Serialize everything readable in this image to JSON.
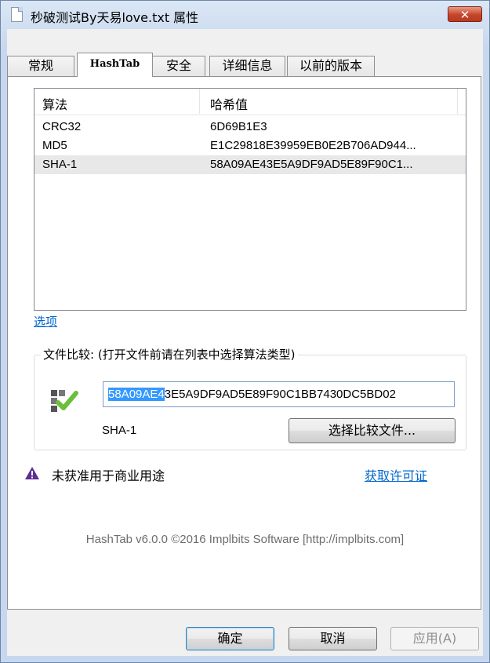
{
  "window": {
    "title": "秒破测试By天易love.txt 属性",
    "close_label": "✕"
  },
  "tabs": [
    {
      "label": "常规"
    },
    {
      "label": "HashTab",
      "active": true
    },
    {
      "label": "安全"
    },
    {
      "label": "详细信息"
    },
    {
      "label": "以前的版本"
    }
  ],
  "hash_list": {
    "columns": [
      "算法",
      "哈希值"
    ],
    "rows": [
      {
        "algorithm": "CRC32",
        "hash": "6D69B1E3"
      },
      {
        "algorithm": "MD5",
        "hash": "E1C29818E39959EB0E2B706AD944..."
      },
      {
        "algorithm": "SHA-1",
        "hash": "58A09AE43E5A9DF9AD5E89F90C1...",
        "selected": true
      }
    ]
  },
  "options_link": "选项",
  "compare": {
    "group_title": "文件比较: (打开文件前请在列表中选择算法类型)",
    "input_selected_part": "58A09AE4",
    "input_rest": "3E5A9DF9AD5E89F90C1BB7430DC5BD02",
    "algorithm": "SHA-1",
    "button_label": "选择比较文件..."
  },
  "warning": {
    "text": "未获准用于商业用途",
    "link": "获取许可证"
  },
  "about": "HashTab v6.0.0 ©2016 Implbits Software [http://implbits.com]",
  "buttons": {
    "ok": "确定",
    "cancel": "取消",
    "apply": "应用(A)"
  },
  "colors": {
    "link": "#0066cc",
    "selection": "#3399ff",
    "close_button": "#c6452a",
    "match_check": "#6cbf3a"
  }
}
